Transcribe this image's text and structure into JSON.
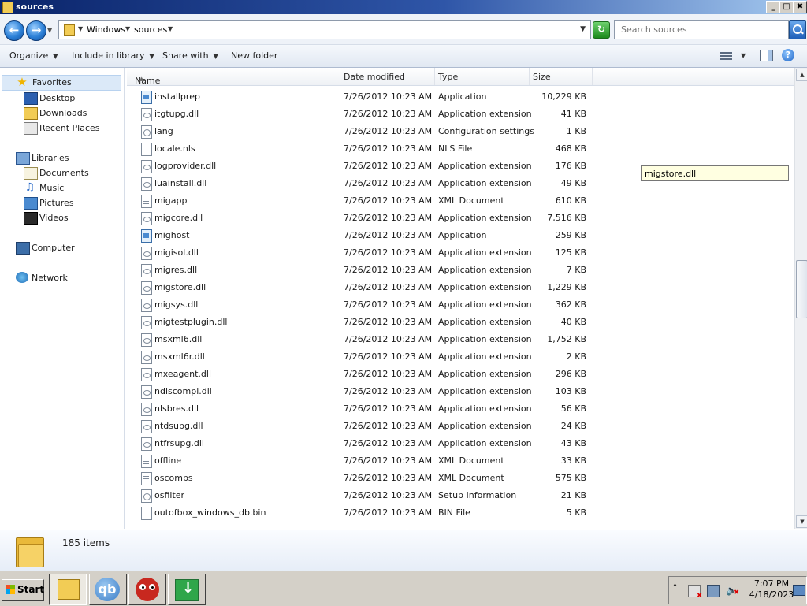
{
  "window": {
    "title": "sources",
    "controls": [
      "_",
      "□",
      "✖"
    ]
  },
  "address": {
    "back_glyph": "←",
    "forward_glyph": "→",
    "crumbs": [
      "Windows",
      "sources"
    ],
    "search_placeholder": "Search sources"
  },
  "toolbar": {
    "organize": "Organize",
    "include_in_library": "Include in library",
    "share_with": "Share with",
    "new_folder": "New folder"
  },
  "nav": {
    "favorites": "Favorites",
    "desktop": "Desktop",
    "downloads": "Downloads",
    "recent_places": "Recent Places",
    "libraries": "Libraries",
    "documents": "Documents",
    "music": "Music",
    "pictures": "Pictures",
    "videos": "Videos",
    "computer": "Computer",
    "network": "Network"
  },
  "columns": {
    "name": "Name",
    "date": "Date modified",
    "type": "Type",
    "size": "Size"
  },
  "files": [
    {
      "name": "installprep",
      "date": "7/26/2012 10:23 AM",
      "type": "Application",
      "size": "10,229 KB",
      "icon": "app"
    },
    {
      "name": "itgtupg.dll",
      "date": "7/26/2012 10:23 AM",
      "type": "Application extension",
      "size": "41 KB",
      "icon": "dll"
    },
    {
      "name": "lang",
      "date": "7/26/2012 10:23 AM",
      "type": "Configuration settings",
      "size": "1 KB",
      "icon": "cfg"
    },
    {
      "name": "locale.nls",
      "date": "7/26/2012 10:23 AM",
      "type": "NLS File",
      "size": "468 KB",
      "icon": "blank"
    },
    {
      "name": "logprovider.dll",
      "date": "7/26/2012 10:23 AM",
      "type": "Application extension",
      "size": "176 KB",
      "icon": "dll"
    },
    {
      "name": "luainstall.dll",
      "date": "7/26/2012 10:23 AM",
      "type": "Application extension",
      "size": "49 KB",
      "icon": "dll"
    },
    {
      "name": "migapp",
      "date": "7/26/2012 10:23 AM",
      "type": "XML Document",
      "size": "610 KB",
      "icon": "xml"
    },
    {
      "name": "migcore.dll",
      "date": "7/26/2012 10:23 AM",
      "type": "Application extension",
      "size": "7,516 KB",
      "icon": "dll"
    },
    {
      "name": "mighost",
      "date": "7/26/2012 10:23 AM",
      "type": "Application",
      "size": "259 KB",
      "icon": "app"
    },
    {
      "name": "migisol.dll",
      "date": "7/26/2012 10:23 AM",
      "type": "Application extension",
      "size": "125 KB",
      "icon": "dll"
    },
    {
      "name": "migres.dll",
      "date": "7/26/2012 10:23 AM",
      "type": "Application extension",
      "size": "7 KB",
      "icon": "dll"
    },
    {
      "name": "migstore.dll",
      "date": "7/26/2012 10:23 AM",
      "type": "Application extension",
      "size": "1,229 KB",
      "icon": "dll"
    },
    {
      "name": "migsys.dll",
      "date": "7/26/2012 10:23 AM",
      "type": "Application extension",
      "size": "362 KB",
      "icon": "dll"
    },
    {
      "name": "migtestplugin.dll",
      "date": "7/26/2012 10:23 AM",
      "type": "Application extension",
      "size": "40 KB",
      "icon": "dll"
    },
    {
      "name": "msxml6.dll",
      "date": "7/26/2012 10:23 AM",
      "type": "Application extension",
      "size": "1,752 KB",
      "icon": "dll"
    },
    {
      "name": "msxml6r.dll",
      "date": "7/26/2012 10:23 AM",
      "type": "Application extension",
      "size": "2 KB",
      "icon": "dll"
    },
    {
      "name": "mxeagent.dll",
      "date": "7/26/2012 10:23 AM",
      "type": "Application extension",
      "size": "296 KB",
      "icon": "dll"
    },
    {
      "name": "ndiscompl.dll",
      "date": "7/26/2012 10:23 AM",
      "type": "Application extension",
      "size": "103 KB",
      "icon": "dll"
    },
    {
      "name": "nlsbres.dll",
      "date": "7/26/2012 10:23 AM",
      "type": "Application extension",
      "size": "56 KB",
      "icon": "dll"
    },
    {
      "name": "ntdsupg.dll",
      "date": "7/26/2012 10:23 AM",
      "type": "Application extension",
      "size": "24 KB",
      "icon": "dll"
    },
    {
      "name": "ntfrsupg.dll",
      "date": "7/26/2012 10:23 AM",
      "type": "Application extension",
      "size": "43 KB",
      "icon": "dll"
    },
    {
      "name": "offline",
      "date": "7/26/2012 10:23 AM",
      "type": "XML Document",
      "size": "33 KB",
      "icon": "xml"
    },
    {
      "name": "oscomps",
      "date": "7/26/2012 10:23 AM",
      "type": "XML Document",
      "size": "575 KB",
      "icon": "xml"
    },
    {
      "name": "osfilter",
      "date": "7/26/2012 10:23 AM",
      "type": "Setup Information",
      "size": "21 KB",
      "icon": "cfg"
    },
    {
      "name": "outofbox_windows_db.bin",
      "date": "7/26/2012 10:23 AM",
      "type": "BIN File",
      "size": "5 KB",
      "icon": "blank"
    }
  ],
  "tooltip": "migstore.dll",
  "details": {
    "count": "185 items"
  },
  "taskbar": {
    "start": "Start",
    "qb_label": "qb",
    "clock_time": "7:07 PM",
    "clock_date": "4/18/2023"
  }
}
